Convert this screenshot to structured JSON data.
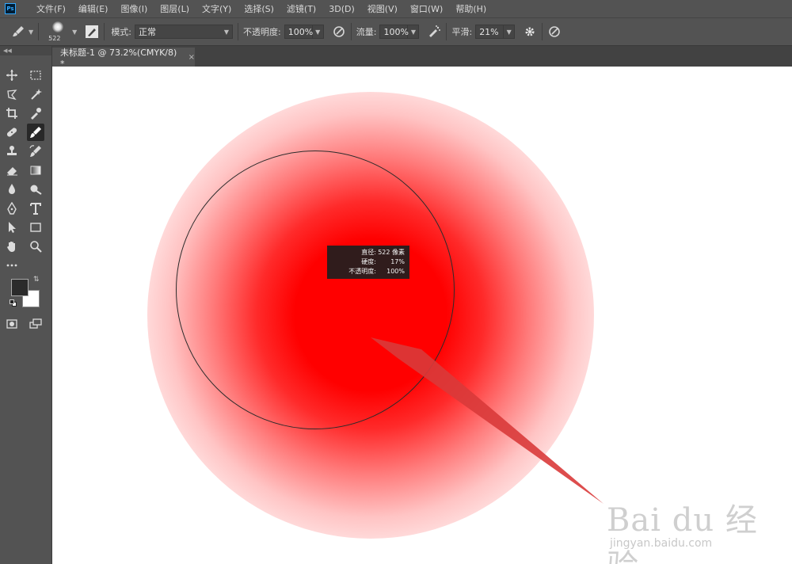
{
  "app": {
    "logo": "Ps"
  },
  "menu": [
    "文件(F)",
    "编辑(E)",
    "图像(I)",
    "图层(L)",
    "文字(Y)",
    "选择(S)",
    "滤镜(T)",
    "3D(D)",
    "视图(V)",
    "窗口(W)",
    "帮助(H)"
  ],
  "options": {
    "brush_size": "522",
    "mode_label": "模式:",
    "mode_value": "正常",
    "opacity_label": "不透明度:",
    "opacity_value": "100%",
    "flow_label": "流量:",
    "flow_value": "100%",
    "smoothing_label": "平滑:",
    "smoothing_value": "21%"
  },
  "document_tab": {
    "title": "未标题-1 @ 73.2%(CMYK/8) *",
    "close": "×"
  },
  "hud": {
    "diameter_label": "直径:",
    "diameter_value": "522 像素",
    "hardness_label": "硬度:",
    "hardness_value": "17%",
    "opacity_label": "不透明度:",
    "opacity_value": "100%"
  },
  "colors": {
    "brush_color": "#ff0000",
    "foreground": "#2b2b2b",
    "background": "#ffffff",
    "annotation": "#d93a3a"
  },
  "watermark": {
    "brand": "Bai du 经验",
    "url": "jingyan.baidu.com"
  }
}
